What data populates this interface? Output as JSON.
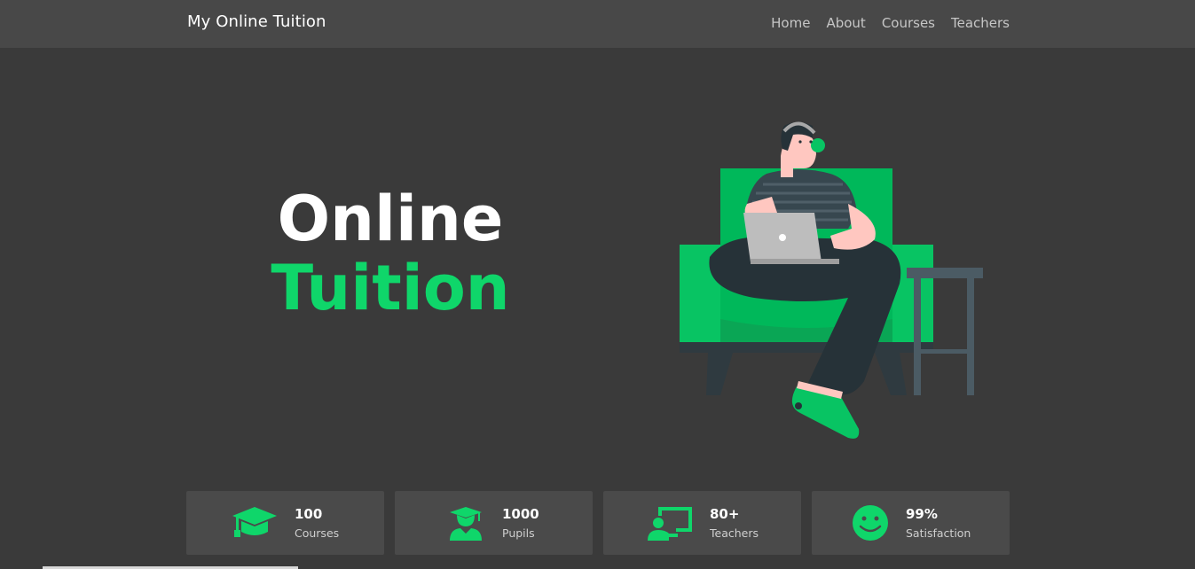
{
  "navbar": {
    "brand": "My Online Tuition",
    "links": [
      "Home",
      "About",
      "Courses",
      "Teachers"
    ]
  },
  "hero": {
    "line1": "Online",
    "line2": "Tuition",
    "illustration_icon": "person-with-laptop-on-sofa-illustration"
  },
  "stats": [
    {
      "value": "100",
      "label": "Courses",
      "icon": "graduation-cap-icon"
    },
    {
      "value": "1000",
      "label": "Pupils",
      "icon": "student-icon"
    },
    {
      "value": "80+",
      "label": "Teachers",
      "icon": "teacher-board-icon"
    },
    {
      "value": "99%",
      "label": "Satisfaction",
      "icon": "smiley-icon"
    }
  ],
  "colors": {
    "accent": "#0fd66a",
    "background": "#3a3a3a",
    "navbar": "#484848",
    "card": "#4a4a4a"
  }
}
